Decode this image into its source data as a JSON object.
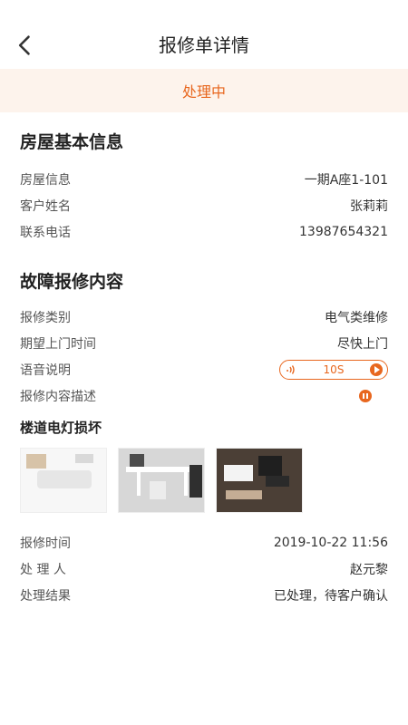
{
  "header": {
    "title": "报修单详情"
  },
  "status": {
    "label": "处理中"
  },
  "house": {
    "section_title": "房屋基本信息",
    "rows": [
      {
        "label": "房屋信息",
        "value": "一期A座1-101"
      },
      {
        "label": "客户姓名",
        "value": "张莉莉"
      },
      {
        "label": "联系电话",
        "value": "13987654321"
      }
    ]
  },
  "fault": {
    "section_title": "故障报修内容",
    "category_label": "报修类别",
    "category_value": "电气类维修",
    "visit_label": "期望上门时间",
    "visit_value": "尽快上门",
    "voice_label": "语音说明",
    "voice_duration": "10S",
    "desc_label": "报修内容描述",
    "description": "楼道电灯损坏"
  },
  "meta": {
    "rows": [
      {
        "label": "报修时间",
        "value": "2019-10-22 11:56"
      },
      {
        "label": "处 理 人",
        "value": "赵元黎"
      },
      {
        "label": "处理结果",
        "value": "已处理，待客户确认"
      }
    ]
  }
}
